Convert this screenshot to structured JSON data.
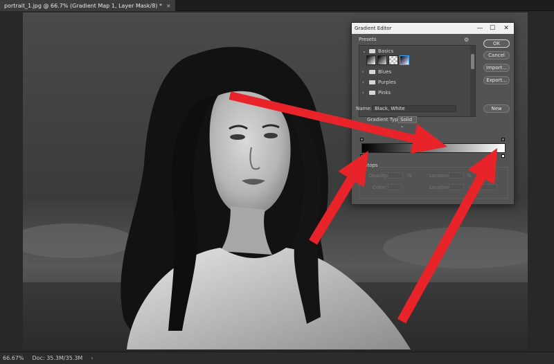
{
  "document": {
    "tab_title": "portrait_1.jpg @ 66.7% (Gradient Map 1, Layer Mask/8) *",
    "close_glyph": "×"
  },
  "status": {
    "zoom": "66.67%",
    "doc_size": "Doc: 35.3M/35.3M",
    "arrow": "›"
  },
  "dialog": {
    "title": "Gradient Editor",
    "minimize": "—",
    "maximize": "☐",
    "close": "✕",
    "presets_label": "Presets",
    "gear_glyph": "⚙",
    "groups": [
      {
        "label": "Basics",
        "expanded": true
      },
      {
        "label": "Blues",
        "expanded": false
      },
      {
        "label": "Purples",
        "expanded": false
      },
      {
        "label": "Pinks",
        "expanded": false
      }
    ],
    "buttons": {
      "ok": "OK",
      "cancel": "Cancel",
      "import": "Import...",
      "export": "Export...",
      "new": "New"
    },
    "name_label": "Name:",
    "name_value": "Black, White",
    "gradient_type_label": "Gradient Type:",
    "gradient_type_value": "Solid",
    "stops_label": "Stops",
    "opacity_label": "Opacity:",
    "opacity_unit": "%",
    "location_label": "Location:",
    "location_unit": "%",
    "color_label": "Color:",
    "location2_label": "Location:"
  },
  "colors": {
    "annotation_arrow": "#e8232a",
    "dialog_bg": "#535353",
    "accent": "#2ea8ff"
  }
}
